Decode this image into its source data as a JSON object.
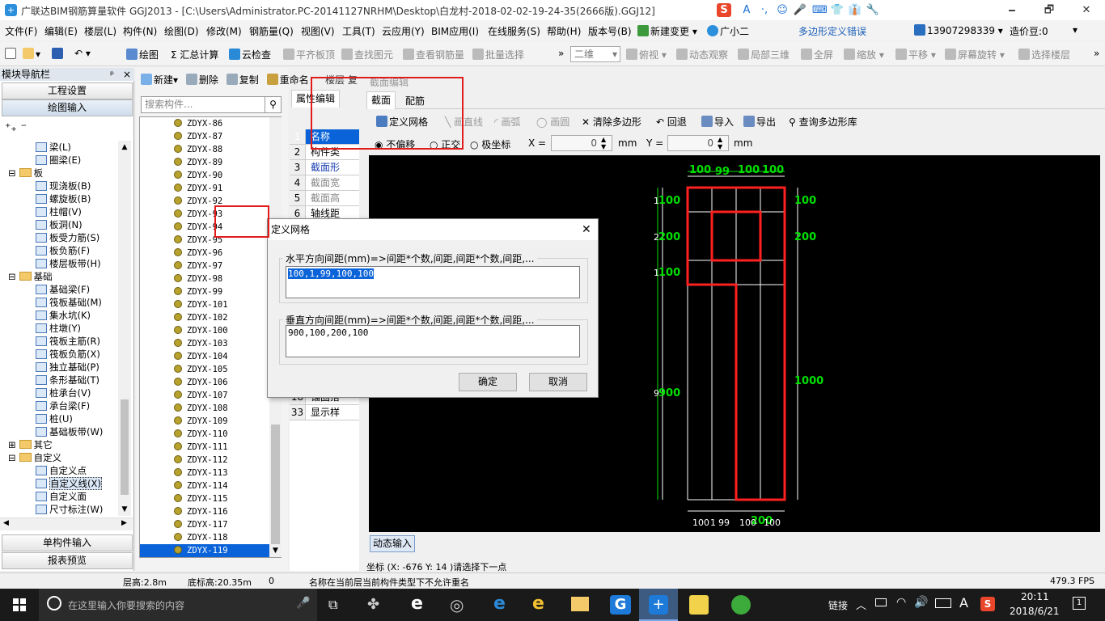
{
  "window": {
    "title": "广联达BIM钢筋算量软件 GGJ2013 - [C:\\Users\\Administrator.PC-20141127NRHM\\Desktop\\白龙村-2018-02-02-19-24-35(2666版).GGJ12]",
    "controls": [
      "🗕",
      "🗗",
      "✕"
    ]
  },
  "ime": {
    "icons": [
      "S",
      "A",
      "·,",
      "☺",
      "🎤",
      "⌨",
      "👕",
      "👔",
      "🔧"
    ]
  },
  "menu": {
    "items": [
      "文件(F)",
      "编辑(E)",
      "楼层(L)",
      "构件(N)",
      "绘图(D)",
      "修改(M)",
      "钢筋量(Q)",
      "视图(V)",
      "工具(T)",
      "云应用(Y)",
      "BIM应用(I)",
      "在线服务(S)",
      "帮助(H)",
      "版本号(B)",
      "新建变更",
      "广小二"
    ],
    "status_error": "多边形定义错误",
    "phone": "13907298339",
    "beans": "造价豆:0"
  },
  "toolbar": {
    "items": [
      "绘图",
      "汇总计算",
      "云检查",
      "平齐板顶",
      "查找图元",
      "查看钢筋量",
      "批量选择"
    ],
    "view_mode": "二维",
    "view_items": [
      "俯视",
      "动态观察",
      "局部三维",
      "全屏",
      "缩放",
      "平移",
      "屏幕旋转",
      "选择楼层"
    ]
  },
  "nav": {
    "header": "模块导航栏",
    "pin": "ᵖ",
    "close": "×",
    "top_buttons": [
      "工程设置",
      "绘图输入"
    ],
    "tree": [
      {
        "label": "梁(L)",
        "level": 2
      },
      {
        "label": "圈梁(E)",
        "level": 2
      },
      {
        "label": "板",
        "level": 1,
        "folder": true,
        "expand": "⊟"
      },
      {
        "label": "现浇板(B)",
        "level": 2
      },
      {
        "label": "螺旋板(B)",
        "level": 2
      },
      {
        "label": "柱帽(V)",
        "level": 2
      },
      {
        "label": "板洞(N)",
        "level": 2
      },
      {
        "label": "板受力筋(S)",
        "level": 2
      },
      {
        "label": "板负筋(F)",
        "level": 2
      },
      {
        "label": "楼层板带(H)",
        "level": 2
      },
      {
        "label": "基础",
        "level": 1,
        "folder": true,
        "expand": "⊟"
      },
      {
        "label": "基础梁(F)",
        "level": 2
      },
      {
        "label": "筏板基础(M)",
        "level": 2
      },
      {
        "label": "集水坑(K)",
        "level": 2
      },
      {
        "label": "柱墩(Y)",
        "level": 2
      },
      {
        "label": "筏板主筋(R)",
        "level": 2
      },
      {
        "label": "筏板负筋(X)",
        "level": 2
      },
      {
        "label": "独立基础(P)",
        "level": 2
      },
      {
        "label": "条形基础(T)",
        "level": 2
      },
      {
        "label": "桩承台(V)",
        "level": 2
      },
      {
        "label": "承台梁(F)",
        "level": 2
      },
      {
        "label": "桩(U)",
        "level": 2
      },
      {
        "label": "基础板带(W)",
        "level": 2
      },
      {
        "label": "其它",
        "level": 1,
        "folder": true,
        "expand": "⊞"
      },
      {
        "label": "自定义",
        "level": 1,
        "folder": true,
        "expand": "⊟"
      },
      {
        "label": "自定义点",
        "level": 2
      },
      {
        "label": "自定义线(X)",
        "level": 2,
        "selected": true
      },
      {
        "label": "自定义面",
        "level": 2
      },
      {
        "label": "尺寸标注(W)",
        "level": 2
      }
    ],
    "bottom_buttons": [
      "单构件输入",
      "报表预览"
    ]
  },
  "components": {
    "toolbar": [
      "新建",
      "删除",
      "复制",
      "重命名",
      "楼层",
      "复"
    ],
    "search_placeholder": "搜索构件...",
    "items": [
      "ZDYX-86",
      "ZDYX-87",
      "ZDYX-88",
      "ZDYX-89",
      "ZDYX-90",
      "ZDYX-91",
      "ZDYX-92",
      "ZDYX-93",
      "ZDYX-94",
      "ZDYX-95",
      "ZDYX-96",
      "ZDYX-97",
      "ZDYX-98",
      "ZDYX-99",
      "ZDYX-101",
      "ZDYX-102",
      "ZDYX-100",
      "ZDYX-103",
      "ZDYX-104",
      "ZDYX-105",
      "ZDYX-106",
      "ZDYX-107",
      "ZDYX-108",
      "ZDYX-109",
      "ZDYX-110",
      "ZDYX-111",
      "ZDYX-112",
      "ZDYX-113",
      "ZDYX-114",
      "ZDYX-115",
      "ZDYX-116",
      "ZDYX-117",
      "ZDYX-118",
      "ZDYX-119"
    ],
    "selected": "ZDYX-119"
  },
  "properties": {
    "tab": "属性编辑",
    "rows": [
      {
        "n": "1",
        "label": "名称"
      },
      {
        "n": "2",
        "label": "构件类"
      },
      {
        "n": "3",
        "label": "截面形"
      },
      {
        "n": "4",
        "label": "截面宽"
      },
      {
        "n": "5",
        "label": "截面高"
      },
      {
        "n": "6",
        "label": "轴线距"
      }
    ],
    "rows_bottom": [
      {
        "n": "18",
        "label": "锚固搭"
      },
      {
        "n": "33",
        "label": "显示样"
      }
    ]
  },
  "section_editor": {
    "title": "截面编辑",
    "tabs": [
      "截面",
      "配筋"
    ],
    "tools": [
      "定义网格",
      "画直线",
      "画弧",
      "画圆",
      "清除多边形",
      "回退",
      "导入",
      "导出",
      "查询多边形库"
    ],
    "offset": {
      "options": [
        "不偏移",
        "正交",
        "极坐标"
      ],
      "x_label": "X =",
      "y_label": "Y =",
      "x_value": "0",
      "y_value": "0",
      "unit": "mm"
    },
    "grid_top_labels": [
      "100",
      "99",
      "100",
      "100"
    ],
    "grid_bottom_labels": [
      "100",
      "1",
      "99",
      "100",
      "100"
    ],
    "grid_left_labels": [
      "100",
      "200",
      "100",
      "900"
    ],
    "grid_left_overlap": [
      "1",
      "2",
      "1",
      "9"
    ],
    "grid_right_labels": [
      "100",
      "200",
      "1000"
    ],
    "bottom_dim": "200",
    "dynamic_input": "动态输入",
    "coords": "坐标 (X: -676 Y: 14 )请选择下一点"
  },
  "dialog": {
    "title": "定义网格",
    "horizontal_label": "水平方向间距(mm)=>间距*个数,间距,间距*个数,间距,...",
    "horizontal_value": "100,1,99,100,100",
    "vertical_label": "垂直方向间距(mm)=>间距*个数,间距,间距*个数,间距,...",
    "vertical_value": "900,100,200,100",
    "ok": "确定",
    "cancel": "取消"
  },
  "status": {
    "floor_height": "层高:2.8m",
    "bottom_elev": "底标高:20.35m",
    "zero": "0",
    "message": "名称在当前层当前构件类型下不允许重名",
    "fps": "479.3 FPS"
  },
  "taskbar": {
    "search_placeholder": "在这里输入你要搜索的内容",
    "tray_link": "链接",
    "time": "20:11",
    "date": "2018/6/21",
    "notif": "1",
    "lang": "A"
  }
}
